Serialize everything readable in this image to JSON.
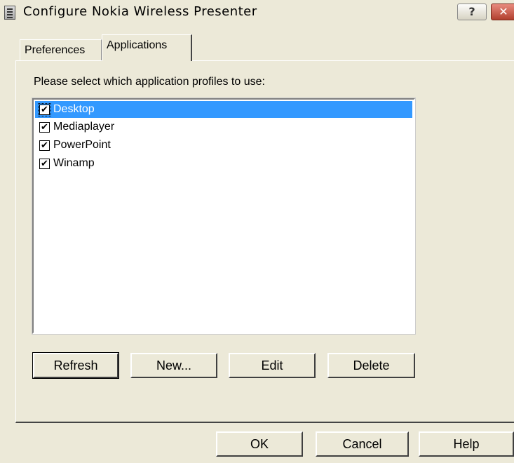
{
  "window": {
    "title": "Configure Nokia Wireless Presenter",
    "help_button": "?",
    "close_button": "✕"
  },
  "tabs": [
    {
      "label": "Preferences",
      "active": false
    },
    {
      "label": "Applications",
      "active": true
    }
  ],
  "applications_tab": {
    "prompt": "Please select which application profiles to use:",
    "profiles": [
      {
        "label": "Desktop",
        "checked": true,
        "selected": true
      },
      {
        "label": "Mediaplayer",
        "checked": true,
        "selected": false
      },
      {
        "label": "PowerPoint",
        "checked": true,
        "selected": false
      },
      {
        "label": "Winamp",
        "checked": true,
        "selected": false
      }
    ],
    "buttons": {
      "refresh": "Refresh",
      "new": "New...",
      "edit": "Edit",
      "delete": "Delete"
    }
  },
  "dialog_buttons": {
    "ok": "OK",
    "cancel": "Cancel",
    "help": "Help"
  },
  "check_glyph": "✔",
  "colors": {
    "face": "#ece9d8",
    "selection": "#3399ff",
    "close_button": "#b1402e"
  }
}
